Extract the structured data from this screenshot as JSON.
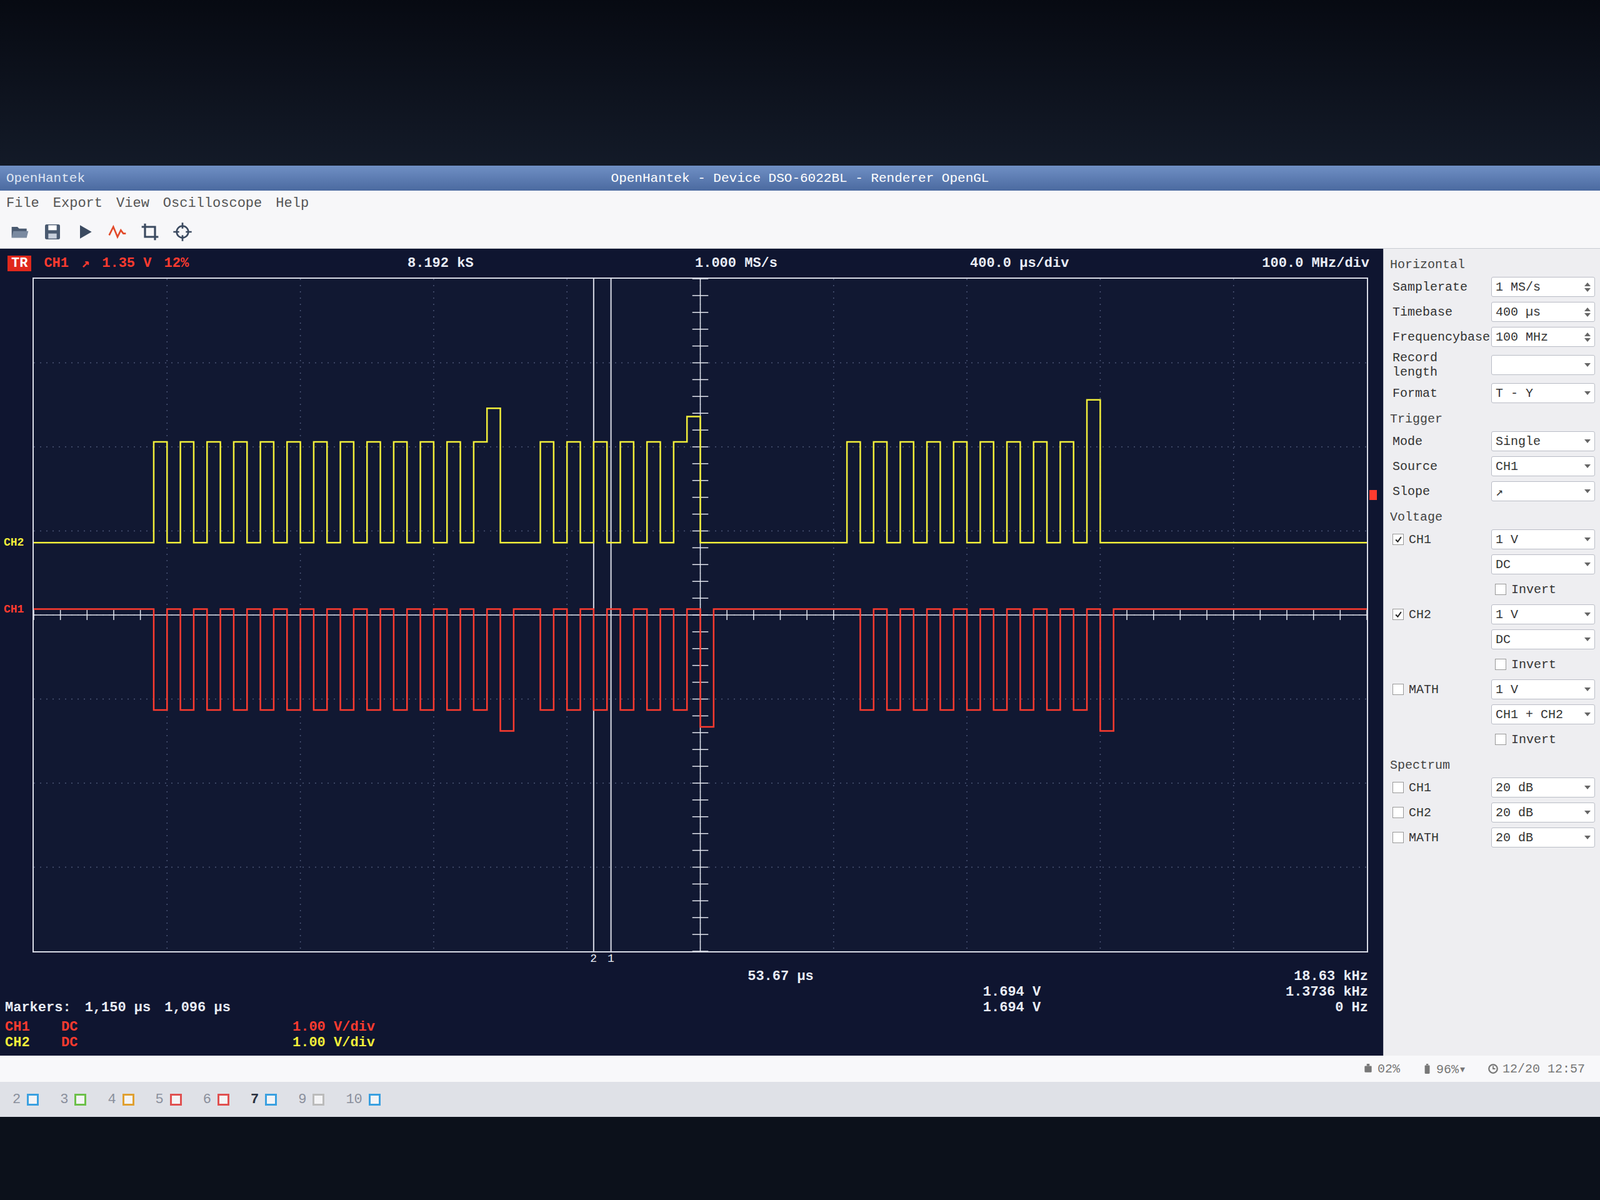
{
  "window": {
    "app": "OpenHantek",
    "title": "OpenHantek - Device DSO-6022BL - Renderer OpenGL"
  },
  "menu": [
    "File",
    "Export",
    "View",
    "Oscilloscope",
    "Help"
  ],
  "scope_header": {
    "trigger_badge": "TR",
    "channel": "CH1",
    "slope": "↗",
    "level": "1.35 V",
    "position": "12%",
    "samples": "8.192 kS",
    "samplerate": "1.000 MS/s",
    "timebase": "400.0 µs/div",
    "frequencybase": "100.0 MHz/div"
  },
  "chart": {
    "series": [
      {
        "name": "CH2",
        "color": "#f2ef3a",
        "offset": 0.86,
        "values": [
          0,
          0,
          0,
          0,
          0,
          0,
          0,
          0,
          0,
          1.2,
          0,
          1.2,
          0,
          1.2,
          0,
          1.2,
          0,
          1.2,
          0,
          1.2,
          0,
          1.2,
          0,
          1.2,
          0,
          1.2,
          0,
          1.2,
          0,
          1.2,
          0,
          1.2,
          0,
          1.2,
          1.6,
          0,
          0,
          0,
          1.2,
          0,
          1.2,
          0,
          1.2,
          0,
          1.2,
          0,
          1.2,
          0,
          1.2,
          1.5,
          0,
          0,
          0,
          0,
          0,
          0,
          0,
          0,
          0,
          0,
          0,
          1.2,
          0,
          1.2,
          0,
          1.2,
          0,
          1.2,
          0,
          1.2,
          0,
          1.2,
          0,
          1.2,
          0,
          1.2,
          0,
          1.2,
          0,
          1.7,
          0,
          0,
          0,
          0,
          0,
          0,
          0,
          0,
          0,
          0,
          0,
          0,
          0,
          0,
          0,
          0,
          0,
          0,
          0,
          0
        ]
      },
      {
        "name": "CH1",
        "color": "#ff3b2f",
        "offset": 0.07,
        "values": [
          0,
          0,
          0,
          0,
          0,
          0,
          0,
          0,
          0,
          -1.2,
          0,
          -1.2,
          0,
          -1.2,
          0,
          -1.2,
          0,
          -1.2,
          0,
          -1.2,
          0,
          -1.2,
          0,
          -1.2,
          0,
          -1.2,
          0,
          -1.2,
          0,
          -1.2,
          0,
          -1.2,
          0,
          -1.2,
          0,
          -1.45,
          0,
          0,
          -1.2,
          0,
          -1.2,
          0,
          -1.2,
          0,
          -1.2,
          0,
          -1.2,
          0,
          -1.2,
          0,
          -1.4,
          0,
          0,
          0,
          0,
          0,
          0,
          0,
          0,
          0,
          0,
          0,
          -1.2,
          0,
          -1.2,
          0,
          -1.2,
          0,
          -1.2,
          0,
          -1.2,
          0,
          -1.2,
          0,
          -1.2,
          0,
          -1.2,
          0,
          -1.2,
          0,
          -1.45,
          0,
          0,
          0,
          0,
          0,
          0,
          0,
          0,
          0,
          0,
          0,
          0,
          0,
          0,
          0,
          0,
          0,
          0,
          0
        ]
      }
    ],
    "markers": [
      {
        "label": "2",
        "position": 4.2
      },
      {
        "label": "1",
        "position": 4.33
      }
    ],
    "trigger_marker": 1.42
  },
  "measurements": {
    "markers_label": "Markers:",
    "marker_times": [
      "1,150 µs",
      "1,096 µs"
    ],
    "delta": "53.67 µs",
    "voltages": [
      "1.694 V",
      "1.694 V"
    ],
    "frequencies": [
      "18.63 kHz",
      "1.3736 kHz",
      "0 Hz"
    ]
  },
  "channel_info": [
    {
      "name": "CH1",
      "coupling": "DC",
      "scale": "1.00 V/div",
      "color": "#ff3b2f"
    },
    {
      "name": "CH2",
      "coupling": "DC",
      "scale": "1.00 V/div",
      "color": "#f2ef3a"
    }
  ],
  "dock": {
    "horizontal": {
      "title": "Horizontal",
      "fields": [
        {
          "label": "Samplerate",
          "value": "1 MS/s",
          "kind": "spin"
        },
        {
          "label": "Timebase",
          "value": "400 µs",
          "kind": "spin"
        },
        {
          "label": "Frequencybase",
          "value": "100 MHz",
          "kind": "spin"
        },
        {
          "label": "Record length",
          "value": "",
          "kind": "combo"
        },
        {
          "label": "Format",
          "value": "T - Y",
          "kind": "combo"
        }
      ]
    },
    "trigger": {
      "title": "Trigger",
      "fields": [
        {
          "label": "Mode",
          "value": "Single",
          "kind": "combo"
        },
        {
          "label": "Source",
          "value": "CH1",
          "kind": "combo"
        },
        {
          "label": "Slope",
          "value": "↗",
          "kind": "combo"
        }
      ]
    },
    "voltage": {
      "title": "Voltage",
      "channels": [
        {
          "name": "CH1",
          "checked": true,
          "gain": "1 V",
          "mode": "DC",
          "invert_label": "Invert",
          "invert": false
        },
        {
          "name": "CH2",
          "checked": true,
          "gain": "1 V",
          "mode": "DC",
          "invert_label": "Invert",
          "invert": false
        },
        {
          "name": "MATH",
          "checked": false,
          "gain": "1 V",
          "mode": "CH1 + CH2",
          "invert_label": "Invert",
          "invert": false
        }
      ]
    },
    "spectrum": {
      "title": "Spectrum",
      "channels": [
        {
          "name": "CH1",
          "checked": false,
          "magnitude": "20 dB"
        },
        {
          "name": "CH2",
          "checked": false,
          "magnitude": "20 dB"
        },
        {
          "name": "MATH",
          "checked": false,
          "magnitude": "20 dB"
        }
      ]
    }
  },
  "tray": [
    {
      "kind": "cpu",
      "text": "02%"
    },
    {
      "kind": "battery",
      "text": "96%▾"
    },
    {
      "kind": "clock",
      "text": "12/20 12:57"
    }
  ],
  "taskbar": {
    "workspaces": [
      {
        "label": "2",
        "selected": false,
        "color": "#3aa0e0"
      },
      {
        "label": "3",
        "selected": false,
        "color": "#6cc04a"
      },
      {
        "label": "4",
        "selected": false,
        "color": "#e0a030"
      },
      {
        "label": "5",
        "selected": false,
        "color": "#e05050"
      },
      {
        "label": "6",
        "selected": false,
        "color": "#e05050"
      },
      {
        "label": "7",
        "selected": true,
        "color": "#3aa0e0"
      },
      {
        "label": "9",
        "selected": false,
        "color": "#bbbbbb"
      },
      {
        "label": "10",
        "selected": false,
        "color": "#3aa0e0"
      }
    ]
  }
}
